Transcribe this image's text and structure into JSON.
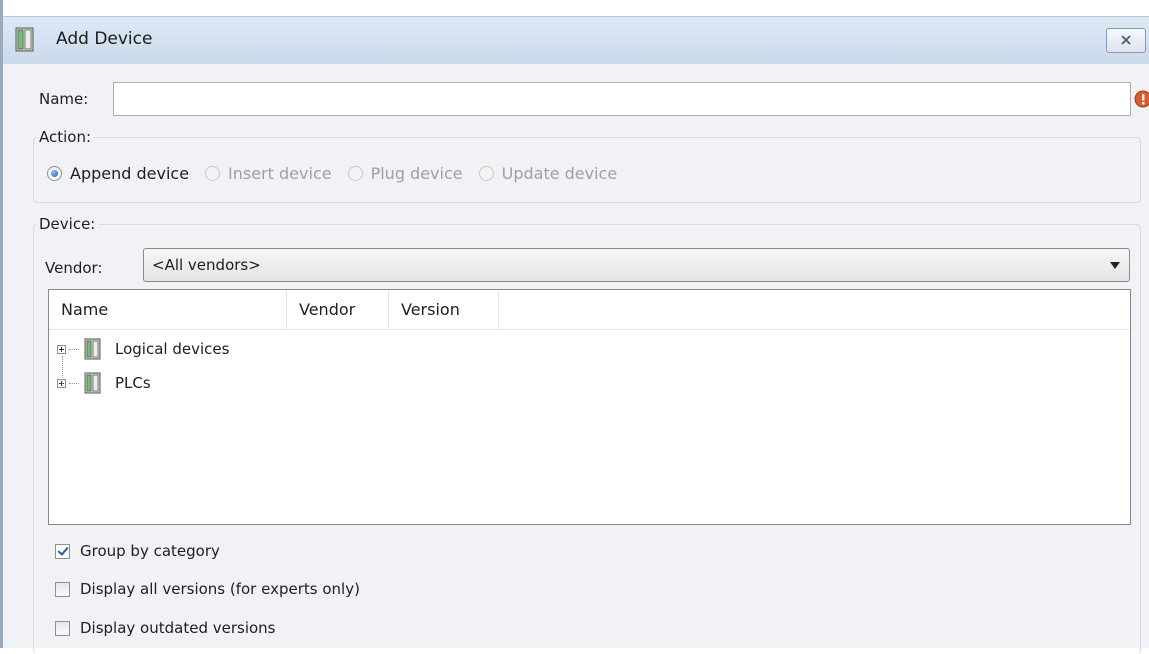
{
  "window": {
    "title": "Add Device"
  },
  "name_field": {
    "label": "Name:",
    "value": ""
  },
  "action": {
    "label": "Action:",
    "options": [
      {
        "label": "Append device",
        "selected": true,
        "enabled": true
      },
      {
        "label": "Insert device",
        "selected": false,
        "enabled": false
      },
      {
        "label": "Plug device",
        "selected": false,
        "enabled": false
      },
      {
        "label": "Update device",
        "selected": false,
        "enabled": false
      }
    ]
  },
  "device": {
    "label": "Device:",
    "vendor_label": "Vendor:",
    "vendor_value": "<All vendors>",
    "columns": [
      "Name",
      "Vendor",
      "Version"
    ],
    "tree_items": [
      "Logical devices",
      "PLCs"
    ],
    "options": [
      {
        "label": "Group by category",
        "checked": true
      },
      {
        "label": "Display all versions (for experts only)",
        "checked": false
      },
      {
        "label": "Display outdated versions",
        "checked": false
      }
    ]
  },
  "icons": {
    "device": "device-icon",
    "error": "error-icon",
    "close": "close-icon"
  },
  "colors": {
    "titlebar": "#d3e0ef",
    "content_bg": "#f0f2f5",
    "error": "#e05a28"
  }
}
